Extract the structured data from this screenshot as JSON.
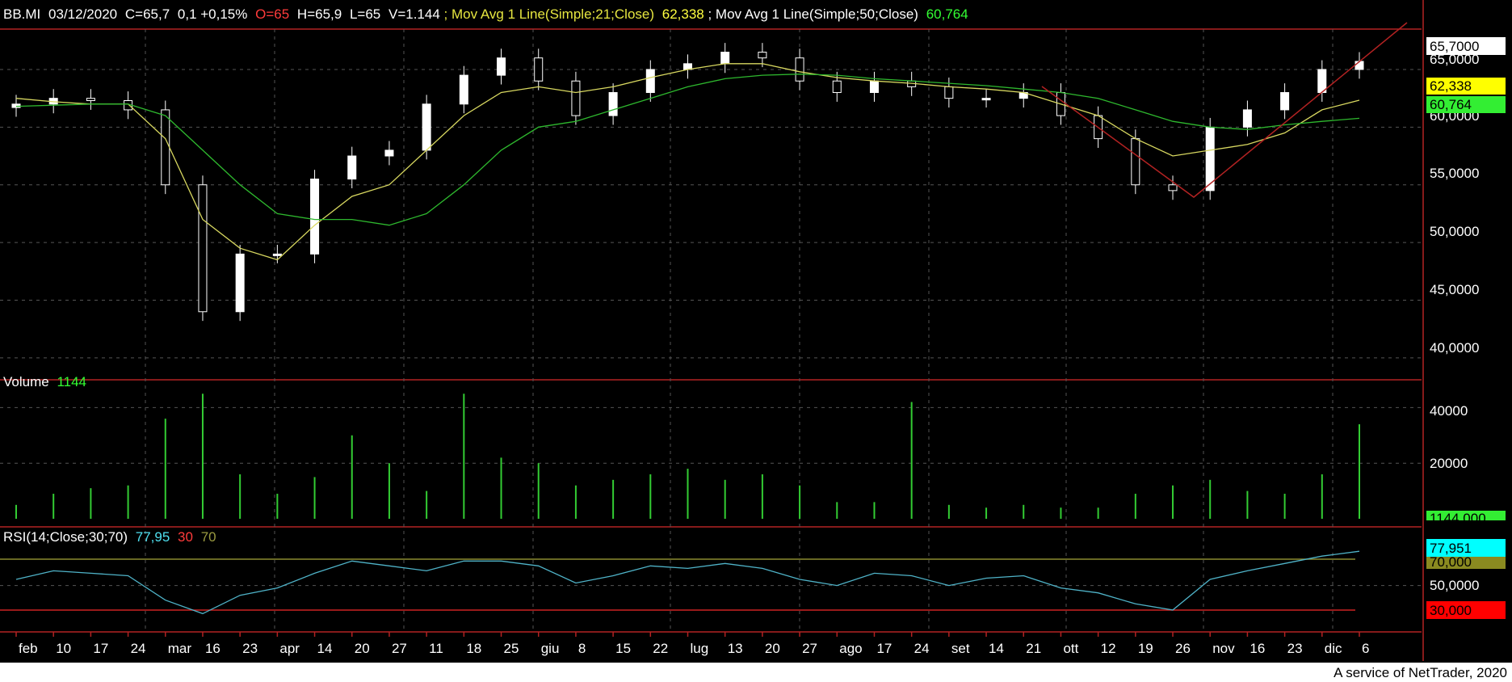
{
  "header": {
    "symbol": "BB.MI",
    "date": "03/12/2020",
    "close": "C=65,7",
    "change": "0,1 +0,15%",
    "open": "O=65",
    "high": "H=65,9",
    "low": "L=65",
    "volume": "V=1.144",
    "ma21_label": "; Mov Avg 1 Line(Simple;21;Close)",
    "ma21_value": "62,338",
    "ma50_label": "; Mov Avg 1 Line(Simple;50;Close)",
    "ma50_value": "60,764"
  },
  "price_axis": {
    "ticks": [
      "65,0000",
      "60,0000",
      "55,0000",
      "50,0000",
      "45,0000",
      "40,0000"
    ],
    "last_label": "65,7000",
    "ma21_label": "62,338",
    "ma50_label": "60,764"
  },
  "volume_panel": {
    "title": "Volume",
    "value": "1144",
    "ticks": [
      "40000",
      "20000"
    ],
    "last_label": "1144,000"
  },
  "rsi_panel": {
    "title": "RSI(14;Close;30;70)",
    "value": "77,95",
    "lower": "30",
    "upper": "70",
    "ticks": [
      "50,0000"
    ],
    "last_label": "77,951",
    "upper_label": "70,000",
    "lower_label": "30,000"
  },
  "x_axis": {
    "labels": [
      "feb",
      "10",
      "17",
      "24",
      "mar",
      "16",
      "23",
      "apr",
      "14",
      "20",
      "27",
      "11",
      "18",
      "25",
      "giu",
      "8",
      "15",
      "22",
      "lug",
      "13",
      "20",
      "27",
      "ago",
      "17",
      "24",
      "set",
      "14",
      "21",
      "ott",
      "12",
      "19",
      "26",
      "nov",
      "16",
      "23",
      "dic",
      "6"
    ]
  },
  "footer": "A service of NetTrader, 2020",
  "colors": {
    "background": "#000000",
    "up_candle": "#ffffff",
    "down_candle": "#ffffff",
    "ma21": "#d8d860",
    "ma50": "#2eb82e",
    "volume": "#33cc33",
    "rsi": "#4fb3c8",
    "panel_border": "#b22222",
    "trendline": "#b22222",
    "grid": "#555555"
  },
  "chart_data": {
    "type": "candlestick",
    "symbol": "BB.MI",
    "x": [
      "feb",
      "10",
      "17",
      "24",
      "mar",
      "16",
      "23",
      "apr",
      "14",
      "20",
      "27",
      "11",
      "18",
      "25",
      "giu",
      "8",
      "15",
      "22",
      "lug",
      "13",
      "20",
      "27",
      "ago",
      "17",
      "24",
      "set",
      "14",
      "21",
      "ott",
      "12",
      "19",
      "26",
      "nov",
      "16",
      "23",
      "dic",
      "6"
    ],
    "close": [
      62.0,
      62.5,
      62.3,
      61.5,
      55.0,
      44.0,
      49.0,
      49.0,
      55.5,
      57.5,
      58.0,
      62.0,
      64.5,
      66.0,
      64.0,
      61.0,
      63.0,
      65.0,
      65.5,
      66.5,
      66.0,
      64.0,
      63.0,
      64.0,
      63.5,
      62.5,
      62.5,
      63.0,
      61.0,
      59.0,
      55.0,
      54.5,
      60.0,
      61.5,
      63.0,
      65.0,
      65.7
    ],
    "ma21_close": [
      62.5,
      62.2,
      62.0,
      62.0,
      59.0,
      52.0,
      49.5,
      48.5,
      51.5,
      54.0,
      55.0,
      58.0,
      61.0,
      63.0,
      63.5,
      63.0,
      63.5,
      64.3,
      65.0,
      65.5,
      65.5,
      64.8,
      64.3,
      64.0,
      63.8,
      63.5,
      63.3,
      63.0,
      62.0,
      61.0,
      59.0,
      57.5,
      58.0,
      58.5,
      59.5,
      61.5,
      62.338
    ],
    "ma50_close": [
      61.8,
      61.9,
      62.0,
      62.0,
      61.0,
      58.0,
      55.0,
      52.5,
      52.0,
      52.0,
      51.5,
      52.5,
      55.0,
      58.0,
      60.0,
      60.5,
      61.5,
      62.5,
      63.5,
      64.2,
      64.5,
      64.6,
      64.5,
      64.2,
      64.0,
      63.8,
      63.6,
      63.3,
      63.0,
      62.5,
      61.5,
      60.5,
      60.0,
      59.8,
      60.2,
      60.5,
      60.764
    ],
    "volume": [
      5000,
      9000,
      11000,
      12000,
      36000,
      45000,
      16000,
      9000,
      15000,
      30000,
      20000,
      10000,
      45000,
      22000,
      20000,
      12000,
      14000,
      16000,
      18000,
      14000,
      16000,
      12000,
      6000,
      6000,
      42000,
      5000,
      4000,
      5000,
      4000,
      4000,
      9000,
      12000,
      14000,
      10000,
      9000,
      16000,
      34000
    ],
    "rsi": [
      55,
      62,
      60,
      58,
      38,
      27,
      42,
      48,
      60,
      70,
      66,
      62,
      70,
      70,
      66,
      52,
      58,
      66,
      64,
      68,
      64,
      55,
      50,
      60,
      58,
      50,
      56,
      58,
      48,
      44,
      35,
      30,
      55,
      62,
      68,
      74,
      77.95
    ],
    "ylim_price": [
      39.5,
      68.5
    ],
    "ylim_volume": [
      0,
      50000
    ],
    "ylim_rsi": [
      20,
      90
    ],
    "rsi_levels": {
      "upper": 70,
      "lower": 30
    },
    "last": {
      "close": 65.7,
      "ma21": 62.338,
      "ma50": 60.764,
      "volume": 1144,
      "rsi": 77.951
    }
  }
}
